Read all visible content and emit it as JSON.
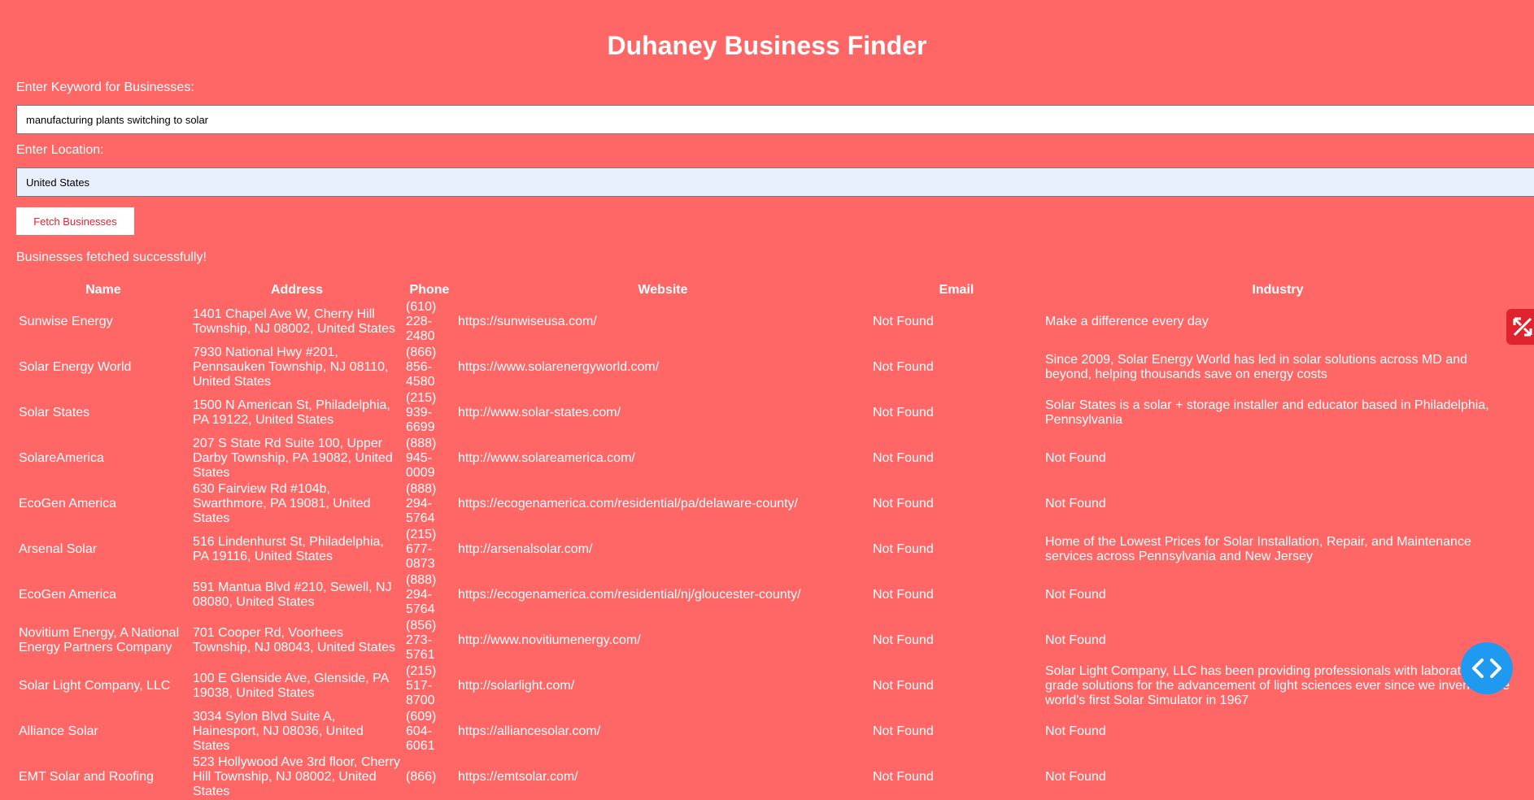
{
  "title": "Duhaney Business Finder",
  "keyword": {
    "label": "Enter Keyword for Businesses:",
    "value": "manufacturing plants switching to solar"
  },
  "location": {
    "label": "Enter Location:",
    "value": "United States"
  },
  "fetch_label": "Fetch Businesses",
  "status": "Businesses fetched successfully!",
  "table": {
    "headers": [
      "Name",
      "Address",
      "Phone",
      "Website",
      "Email",
      "Industry"
    ],
    "rows": [
      [
        "Sunwise Energy",
        "1401 Chapel Ave W, Cherry Hill Township, NJ 08002, United States",
        "(610) 228-2480",
        "https://sunwiseusa.com/",
        "Not Found",
        "Make a difference every day"
      ],
      [
        "Solar Energy World",
        "7930 National Hwy #201, Pennsauken Township, NJ 08110, United States",
        "(866) 856-4580",
        "https://www.solarenergyworld.com/",
        "Not Found",
        "Since 2009, Solar Energy World has led in solar solutions across MD and beyond, helping thousands save on energy costs"
      ],
      [
        "Solar States",
        "1500 N American St, Philadelphia, PA 19122, United States",
        "(215) 939-6699",
        "http://www.solar-states.com/",
        "Not Found",
        "Solar States is a solar + storage installer and educator based in Philadelphia, Pennsylvania"
      ],
      [
        "SolareAmerica",
        "207 S State Rd Suite 100, Upper Darby Township, PA 19082, United States",
        "(888) 945-0009",
        "http://www.solareamerica.com/",
        "Not Found",
        "Not Found"
      ],
      [
        "EcoGen America",
        "630 Fairview Rd #104b, Swarthmore, PA 19081, United States",
        "(888) 294-5764",
        "https://ecogenamerica.com/residential/pa/delaware-county/",
        "Not Found",
        "Not Found"
      ],
      [
        "Arsenal Solar",
        "516 Lindenhurst St, Philadelphia, PA 19116, United States",
        "(215) 677-0873",
        "http://arsenalsolar.com/",
        "Not Found",
        "Home of the Lowest Prices for Solar Installation, Repair, and Maintenance services across Pennsylvania and New Jersey"
      ],
      [
        "EcoGen America",
        "591 Mantua Blvd #210, Sewell, NJ 08080, United States",
        "(888) 294-5764",
        "https://ecogenamerica.com/residential/nj/gloucester-county/",
        "Not Found",
        "Not Found"
      ],
      [
        "Novitium Energy, A National Energy Partners Company",
        "701 Cooper Rd, Voorhees Township, NJ 08043, United States",
        "(856) 273-5761",
        "http://www.novitiumenergy.com/",
        "Not Found",
        "Not Found"
      ],
      [
        "Solar Light Company, LLC",
        "100 E Glenside Ave, Glenside, PA 19038, United States",
        "(215) 517-8700",
        "http://solarlight.com/",
        "Not Found",
        "Solar Light Company, LLC has been providing professionals with laboratory-grade solutions for the advancement of light sciences ever since we invented the world's first Solar Simulator in 1967"
      ],
      [
        "Alliance Solar",
        "3034 Sylon Blvd Suite A, Hainesport, NJ 08036, United States",
        "(609) 604-6061",
        "https://alliancesolar.com/",
        "Not Found",
        "Not Found"
      ],
      [
        "EMT Solar and Roofing",
        "523 Hollywood Ave 3rd floor, Cherry Hill Township, NJ 08002, United States",
        "(866)",
        "https://emtsolar.com/",
        "Not Found",
        "Not Found"
      ]
    ]
  },
  "icons": {
    "side_tab": "expand-icon",
    "fab": "code-icon"
  },
  "colors": {
    "background": "#ff6666",
    "accent": "#e0242e",
    "fab": "#1e9bf0"
  }
}
